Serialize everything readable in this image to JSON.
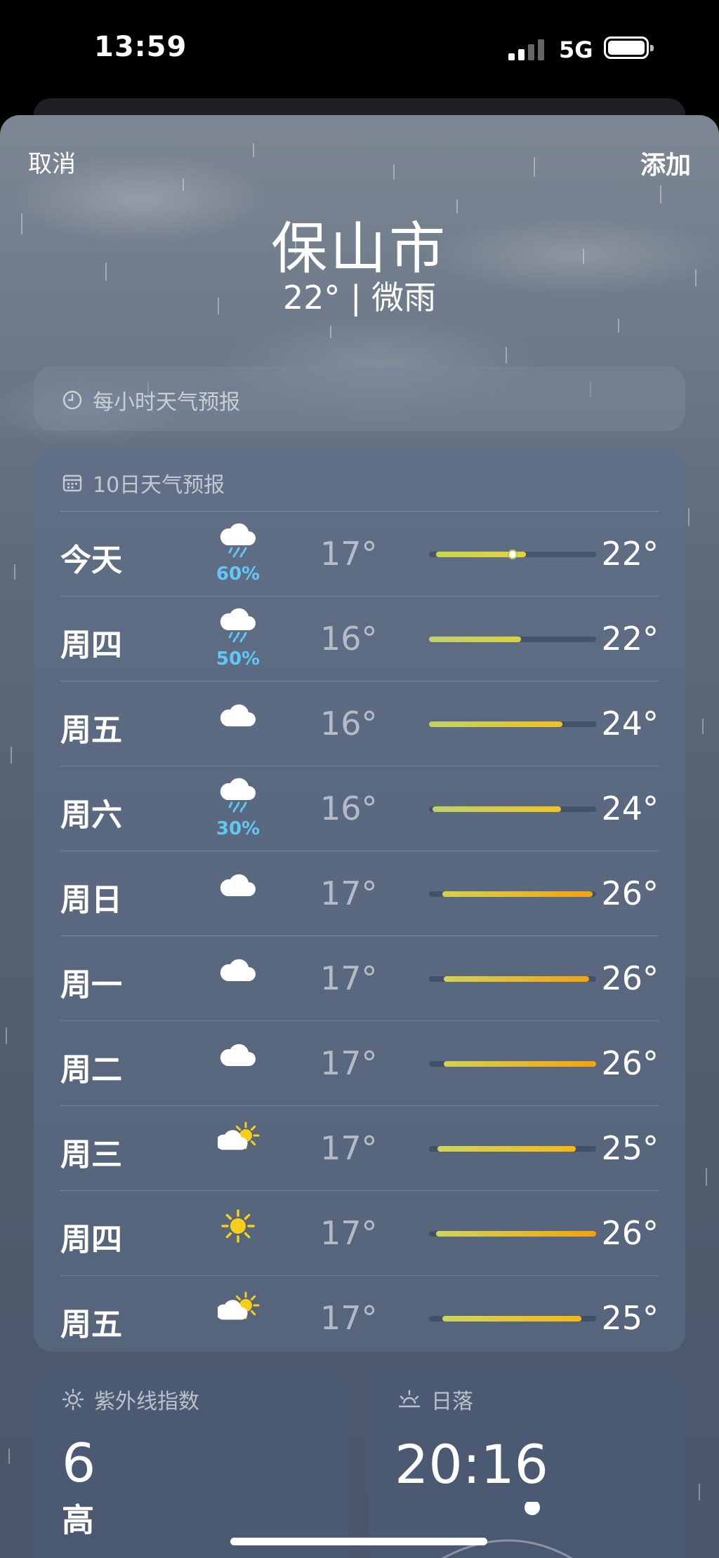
{
  "status": {
    "time": "13:59",
    "network": "5G"
  },
  "header": {
    "cancel_label": "取消",
    "add_label": "添加",
    "city": "保山市",
    "condition": "22° | 微雨"
  },
  "hourly": {
    "title": "每小时天气预报",
    "icon": "clock-icon"
  },
  "forecast": {
    "title": "10日天气预报",
    "icon": "calendar-icon",
    "days": [
      {
        "day": "今天",
        "icon": "rain-cloud-icon",
        "pop": "60%",
        "low": "17°",
        "high": "22°",
        "bar_start": 0.04,
        "bar_end": 0.58,
        "current": 0.5,
        "colors": [
          "#c8d64a",
          "#e6d23a"
        ]
      },
      {
        "day": "周四",
        "icon": "rain-cloud-icon",
        "pop": "50%",
        "low": "16°",
        "high": "22°",
        "bar_start": 0.0,
        "bar_end": 0.55,
        "colors": [
          "#bcd36a",
          "#dcd23e"
        ]
      },
      {
        "day": "周五",
        "icon": "cloud-icon",
        "pop": "",
        "low": "16°",
        "high": "24°",
        "bar_start": 0.0,
        "bar_end": 0.8,
        "colors": [
          "#bcd36a",
          "#f2c41e"
        ]
      },
      {
        "day": "周六",
        "icon": "rain-cloud-icon",
        "pop": "30%",
        "low": "16°",
        "high": "24°",
        "bar_start": 0.02,
        "bar_end": 0.79,
        "colors": [
          "#bcd36a",
          "#f2c41e"
        ]
      },
      {
        "day": "周日",
        "icon": "cloud-icon",
        "pop": "",
        "low": "17°",
        "high": "26°",
        "bar_start": 0.08,
        "bar_end": 0.98,
        "colors": [
          "#d2d250",
          "#f5a20e"
        ]
      },
      {
        "day": "周一",
        "icon": "cloud-icon",
        "pop": "",
        "low": "17°",
        "high": "26°",
        "bar_start": 0.09,
        "bar_end": 0.96,
        "colors": [
          "#d2d250",
          "#f5a20e"
        ]
      },
      {
        "day": "周二",
        "icon": "cloud-icon",
        "pop": "",
        "low": "17°",
        "high": "26°",
        "bar_start": 0.09,
        "bar_end": 1.0,
        "colors": [
          "#d2d250",
          "#f5a20e"
        ]
      },
      {
        "day": "周三",
        "icon": "partly-sunny-icon",
        "pop": "",
        "low": "17°",
        "high": "25°",
        "bar_start": 0.05,
        "bar_end": 0.88,
        "colors": [
          "#cdd65a",
          "#f6b812"
        ]
      },
      {
        "day": "周四",
        "icon": "sun-icon",
        "pop": "",
        "low": "17°",
        "high": "26°",
        "bar_start": 0.04,
        "bar_end": 1.0,
        "colors": [
          "#cdd65a",
          "#f5a20e"
        ]
      },
      {
        "day": "周五",
        "icon": "partly-sunny-icon",
        "pop": "",
        "low": "17°",
        "high": "25°",
        "bar_start": 0.08,
        "bar_end": 0.91,
        "colors": [
          "#cdd65a",
          "#f6b812"
        ]
      }
    ]
  },
  "uv": {
    "title": "紫外线指数",
    "icon": "sun-small-icon",
    "value": "6",
    "level": "高"
  },
  "sunset": {
    "title": "日落",
    "icon": "sunset-icon",
    "time": "20:16"
  }
}
